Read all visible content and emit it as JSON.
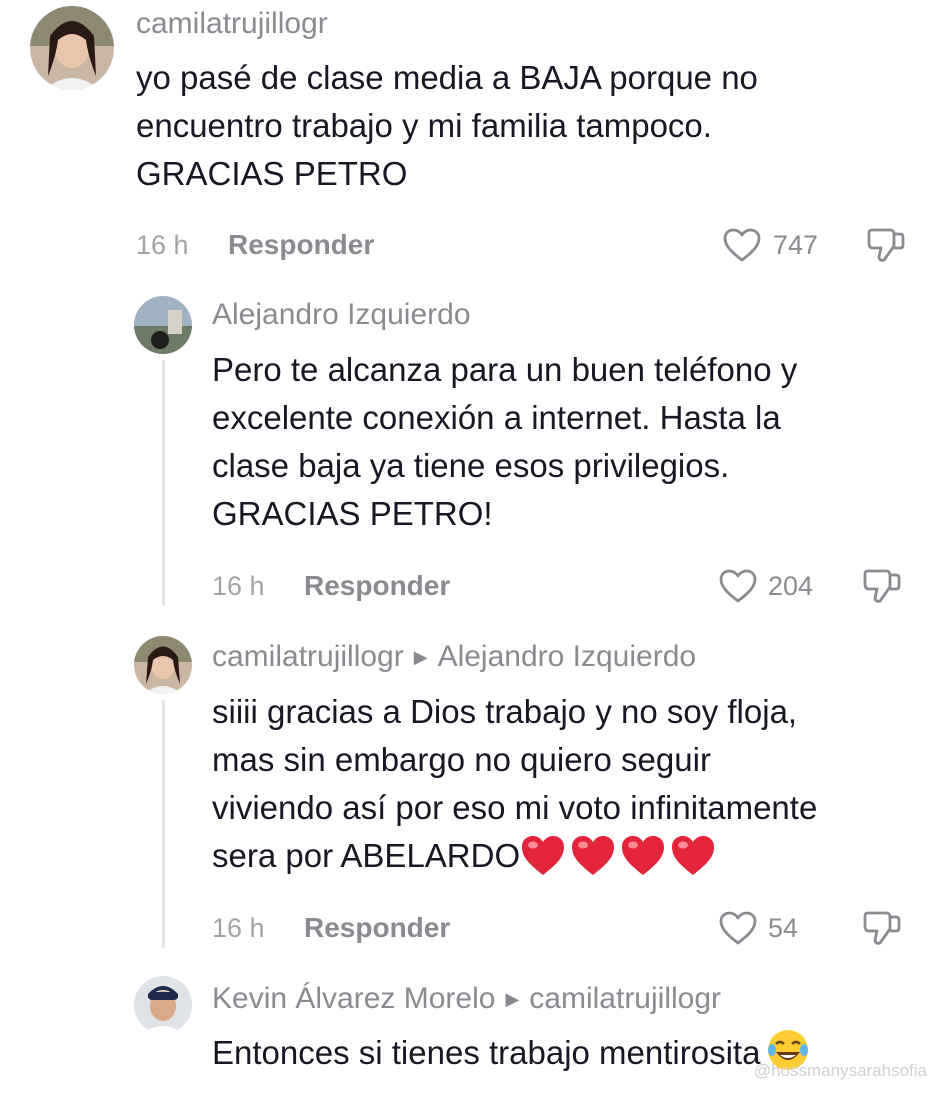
{
  "comments": [
    {
      "username": "camilatrujillogr",
      "reply_to": "",
      "text_lines": [
        "yo pasé de clase media a BAJA porque no",
        "encuentro trabajo y mi familia tampoco.",
        "GRACIAS PETRO"
      ],
      "time": "16 h",
      "reply_label": "Responder",
      "likes": "747"
    },
    {
      "username": "Alejandro Izquierdo",
      "reply_to": "",
      "text_lines": [
        "Pero te alcanza para un buen teléfono y",
        "excelente conexión a internet. Hasta la",
        "clase baja ya tiene esos privilegios.",
        "GRACIAS PETRO!"
      ],
      "time": "16 h",
      "reply_label": "Responder",
      "likes": "204"
    },
    {
      "username": "camilatrujillogr",
      "reply_to": "Alejandro Izquierdo",
      "text_lines": [
        "siiii gracias a Dios trabajo y no soy floja,",
        "mas sin embargo no quiero seguir",
        "viviendo así por eso mi voto infinitamente",
        "sera por ABELARDO"
      ],
      "trailing_emoji": "red-heart x4",
      "time": "16 h",
      "reply_label": "Responder",
      "likes": "54"
    },
    {
      "username": "Kevin Álvarez Morelo",
      "reply_to": "camilatrujillogr",
      "text_lines": [
        "Entonces si tienes trabajo mentirosita"
      ],
      "trailing_emoji": "laughing-tears"
    }
  ],
  "watermark": "@hossmanysarahsofia",
  "icons": {
    "like": "heart-outline-icon",
    "dislike": "thumbs-down-icon",
    "reply_arrow": "caret-right-icon"
  },
  "colors": {
    "text": "#161823",
    "muted": "#8a8b91",
    "heart_emoji": "#e3243b"
  }
}
